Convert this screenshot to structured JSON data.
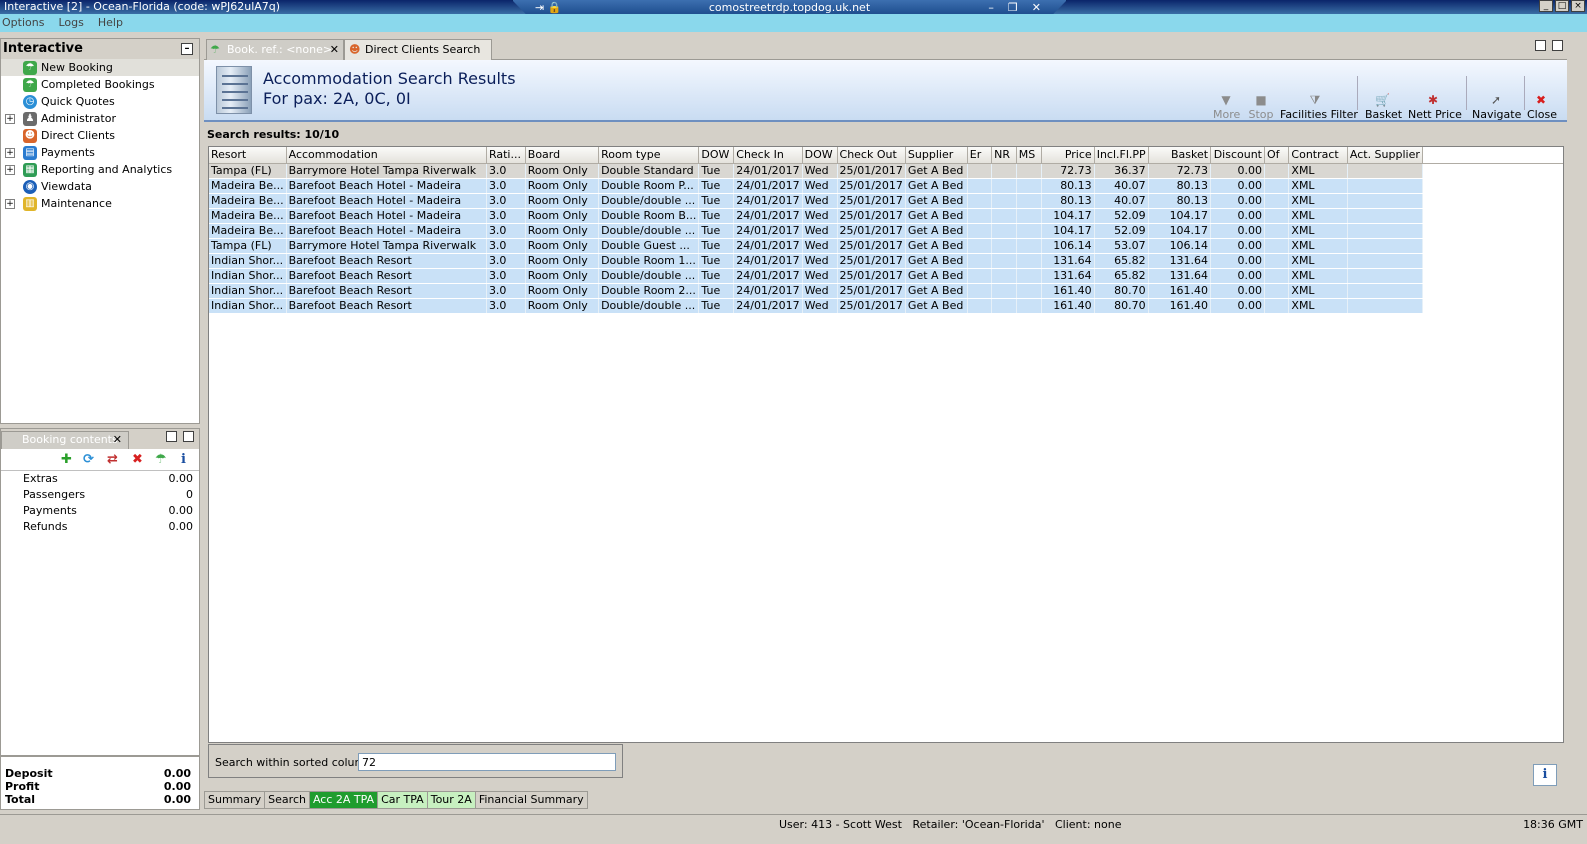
{
  "window": {
    "title": "Interactive [2] - Ocean-Florida (code: wPJ62ulA7q)",
    "rdp_host": "comostreetrdp.topdog.uk.net"
  },
  "menu": [
    "Options",
    "Logs",
    "Help"
  ],
  "left_panel": {
    "title": "Interactive",
    "items": [
      {
        "label": "New Booking",
        "expandable": false,
        "icon": "beach-umbrella-icon"
      },
      {
        "label": "Completed Bookings",
        "expandable": false,
        "icon": "beach-umbrella-icon"
      },
      {
        "label": "Quick Quotes",
        "expandable": false,
        "icon": "clock-icon"
      },
      {
        "label": "Administrator",
        "expandable": true,
        "icon": "person-icon"
      },
      {
        "label": "Direct Clients",
        "expandable": false,
        "icon": "people-icon"
      },
      {
        "label": "Payments",
        "expandable": true,
        "icon": "payments-icon"
      },
      {
        "label": "Reporting and Analytics",
        "expandable": true,
        "icon": "report-icon"
      },
      {
        "label": "Viewdata",
        "expandable": false,
        "icon": "globe-icon"
      },
      {
        "label": "Maintenance",
        "expandable": true,
        "icon": "books-icon"
      }
    ]
  },
  "booking_contents": {
    "tab_label": "Booking contents",
    "rows": [
      {
        "label": "Extras",
        "value": "0.00"
      },
      {
        "label": "Passengers",
        "value": "0"
      },
      {
        "label": "Payments",
        "value": "0.00"
      },
      {
        "label": "Refunds",
        "value": "0.00"
      }
    ],
    "totals": [
      {
        "label": "Deposit",
        "value": "0.00"
      },
      {
        "label": "Profit",
        "value": "0.00"
      },
      {
        "label": "Total",
        "value": "0.00"
      }
    ]
  },
  "tabs": [
    {
      "label": "Book. ref.: <none>",
      "active": false
    },
    {
      "label": "Direct Clients Search",
      "active": true
    }
  ],
  "header": {
    "title": "Accommodation Search Results",
    "subtitle": "For pax: 2A, 0C, 0I"
  },
  "toolbar": [
    {
      "label": "More",
      "disabled": true,
      "icon": "triangle-down-icon"
    },
    {
      "label": "Stop",
      "disabled": true,
      "icon": "stop-icon"
    },
    {
      "label": "Facilities Filter",
      "disabled": false,
      "icon": "funnel-icon"
    },
    {
      "label": "Basket",
      "disabled": false,
      "icon": "basket-icon"
    },
    {
      "label": "Nett Price",
      "disabled": false,
      "icon": "price-icon"
    },
    {
      "label": "Navigate",
      "disabled": false,
      "icon": "navigate-icon"
    },
    {
      "label": "Close",
      "disabled": false,
      "icon": "close-icon"
    }
  ],
  "search_results_label": "Search results: 10/10",
  "table": {
    "columns": [
      "Resort",
      "Accommodation",
      "Rati...",
      "Board",
      "Room type",
      "DOW",
      "Check In",
      "DOW",
      "Check Out",
      "Supplier",
      "Er",
      "NR",
      "MS",
      "Price",
      "Incl.Fl.PP",
      "Basket",
      "Discount",
      "Of",
      "Contract",
      "Act. Supplier"
    ],
    "rows": [
      [
        "Tampa (FL)",
        "Barrymore Hotel Tampa Riverwalk",
        "3.0",
        "Room Only",
        "Double Standard",
        "Tue",
        "24/01/2017",
        "Wed",
        "25/01/2017",
        "Get A Bed",
        "",
        "",
        "",
        "72.73",
        "36.37",
        "72.73",
        "0.00",
        "",
        "XML",
        ""
      ],
      [
        "Madeira Be...",
        "Barefoot Beach Hotel - Madeira",
        "3.0",
        "Room Only",
        "Double Room P...",
        "Tue",
        "24/01/2017",
        "Wed",
        "25/01/2017",
        "Get A Bed",
        "",
        "",
        "",
        "80.13",
        "40.07",
        "80.13",
        "0.00",
        "",
        "XML",
        ""
      ],
      [
        "Madeira Be...",
        "Barefoot Beach Hotel - Madeira",
        "3.0",
        "Room Only",
        "Double/double ...",
        "Tue",
        "24/01/2017",
        "Wed",
        "25/01/2017",
        "Get A Bed",
        "",
        "",
        "",
        "80.13",
        "40.07",
        "80.13",
        "0.00",
        "",
        "XML",
        ""
      ],
      [
        "Madeira Be...",
        "Barefoot Beach Hotel - Madeira",
        "3.0",
        "Room Only",
        "Double Room B...",
        "Tue",
        "24/01/2017",
        "Wed",
        "25/01/2017",
        "Get A Bed",
        "",
        "",
        "",
        "104.17",
        "52.09",
        "104.17",
        "0.00",
        "",
        "XML",
        ""
      ],
      [
        "Madeira Be...",
        "Barefoot Beach Hotel - Madeira",
        "3.0",
        "Room Only",
        "Double/double ...",
        "Tue",
        "24/01/2017",
        "Wed",
        "25/01/2017",
        "Get A Bed",
        "",
        "",
        "",
        "104.17",
        "52.09",
        "104.17",
        "0.00",
        "",
        "XML",
        ""
      ],
      [
        "Tampa (FL)",
        "Barrymore Hotel Tampa Riverwalk",
        "3.0",
        "Room Only",
        "Double Guest ...",
        "Tue",
        "24/01/2017",
        "Wed",
        "25/01/2017",
        "Get A Bed",
        "",
        "",
        "",
        "106.14",
        "53.07",
        "106.14",
        "0.00",
        "",
        "XML",
        ""
      ],
      [
        "Indian Shor...",
        "Barefoot Beach Resort",
        "3.0",
        "Room Only",
        "Double Room 1...",
        "Tue",
        "24/01/2017",
        "Wed",
        "25/01/2017",
        "Get A Bed",
        "",
        "",
        "",
        "131.64",
        "65.82",
        "131.64",
        "0.00",
        "",
        "XML",
        ""
      ],
      [
        "Indian Shor...",
        "Barefoot Beach Resort",
        "3.0",
        "Room Only",
        "Double/double ...",
        "Tue",
        "24/01/2017",
        "Wed",
        "25/01/2017",
        "Get A Bed",
        "",
        "",
        "",
        "131.64",
        "65.82",
        "131.64",
        "0.00",
        "",
        "XML",
        ""
      ],
      [
        "Indian Shor...",
        "Barefoot Beach Resort",
        "3.0",
        "Room Only",
        "Double Room 2...",
        "Tue",
        "24/01/2017",
        "Wed",
        "25/01/2017",
        "Get A Bed",
        "",
        "",
        "",
        "161.40",
        "80.70",
        "161.40",
        "0.00",
        "",
        "XML",
        ""
      ],
      [
        "Indian Shor...",
        "Barefoot Beach Resort",
        "3.0",
        "Room Only",
        "Double/double ...",
        "Tue",
        "24/01/2017",
        "Wed",
        "25/01/2017",
        "Get A Bed",
        "",
        "",
        "",
        "161.40",
        "80.70",
        "161.40",
        "0.00",
        "",
        "XML",
        ""
      ]
    ]
  },
  "search_within": {
    "label": "Search within sorted column:",
    "value": "72"
  },
  "bottom_tabs": [
    {
      "label": "Summary",
      "highlight": "none"
    },
    {
      "label": "Search",
      "highlight": "none"
    },
    {
      "label": "Acc 2A TPA",
      "highlight": "active"
    },
    {
      "label": "Car TPA",
      "highlight": "light"
    },
    {
      "label": "Tour 2A",
      "highlight": "light"
    },
    {
      "label": "Financial Summary",
      "highlight": "none"
    }
  ],
  "status": {
    "user": "User: 413 - Scott West",
    "retailer": "Retailer: 'Ocean-Florida'",
    "client": "Client: none",
    "clock": "18:36 GMT"
  },
  "colors": {
    "menu_bg": "#8ad8ec",
    "row_selected": "#c9e1f7",
    "active_tab_green": "#1f9d2e",
    "light_tab_green": "#c7f0c0"
  }
}
